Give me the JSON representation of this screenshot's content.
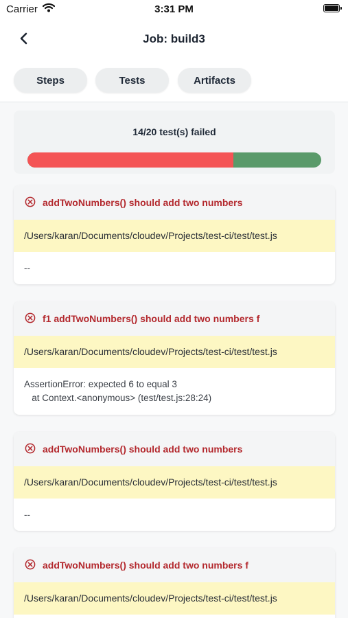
{
  "status_bar": {
    "carrier": "Carrier",
    "time": "3:31 PM"
  },
  "nav": {
    "title": "Job: build3",
    "back_icon": "chevron-left-icon"
  },
  "tabs": [
    {
      "label": "Steps"
    },
    {
      "label": "Tests"
    },
    {
      "label": "Artifacts"
    }
  ],
  "summary": {
    "text": "14/20 test(s) failed",
    "failed": 14,
    "total": 20,
    "failed_color": "#f45455",
    "passed_color": "#5a9a6a"
  },
  "tests": [
    {
      "name": "addTwoNumbers() should add two numbers",
      "path": "/Users/karan/Documents/cloudev/Projects/test-ci/test/test.js",
      "detail": "--"
    },
    {
      "name": "f1 addTwoNumbers() should add two numbers f",
      "path": "/Users/karan/Documents/cloudev/Projects/test-ci/test/test.js",
      "detail": "AssertionError: expected 6 to equal 3\n   at Context.<anonymous> (test/test.js:28:24)"
    },
    {
      "name": "addTwoNumbers() should add two numbers",
      "path": "/Users/karan/Documents/cloudev/Projects/test-ci/test/test.js",
      "detail": "--"
    },
    {
      "name": "addTwoNumbers() should add two numbers f",
      "path": "/Users/karan/Documents/cloudev/Projects/test-ci/test/test.js",
      "detail": ""
    }
  ],
  "colors": {
    "error_red": "#b3282d",
    "path_highlight": "#fdf7c3"
  }
}
